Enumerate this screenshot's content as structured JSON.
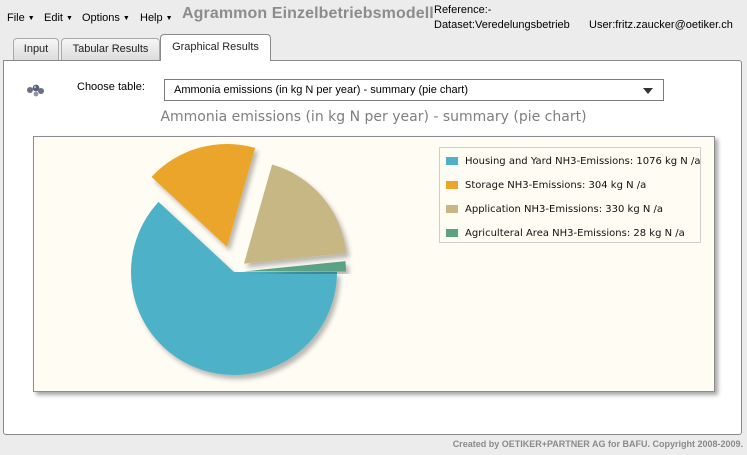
{
  "menu": [
    {
      "label": "File"
    },
    {
      "label": "Edit"
    },
    {
      "label": "Options"
    },
    {
      "label": "Help"
    }
  ],
  "app_title": "Agrammon Einzelbetriebsmodell",
  "meta": {
    "reference": "Reference:-",
    "dataset": "Dataset:Veredelungsbetrieb",
    "user": "User:fritz.zaucker@oetiker.ch"
  },
  "tabs": [
    {
      "label": "Input"
    },
    {
      "label": "Tabular Results"
    },
    {
      "label": "Graphical Results"
    }
  ],
  "choose_table": {
    "label": "Choose table:",
    "selected": "Ammonia emissions (in kg N per year) - summary (pie chart)"
  },
  "chart_data": {
    "type": "pie",
    "title": "Ammonia emissions (in kg N per year) - summary (pie chart)",
    "categories": [
      "Housing and Yard NH3-Emissions: 1076 kg N /a",
      "Storage NH3-Emissions: 304 kg N /a",
      "Application NH3-Emissions: 330 kg N /a",
      "Agriculteral Area NH3-Emissions: 28 kg N /a"
    ],
    "values": [
      1076,
      304,
      330,
      28
    ],
    "colors": [
      "#4eb2c7",
      "#eba52b",
      "#c7b784",
      "#5aa283"
    ],
    "legend_position": "top-right"
  },
  "footer": "Created by OETIKER+PARTNER AG for BAFU. Copyright 2008-2009."
}
